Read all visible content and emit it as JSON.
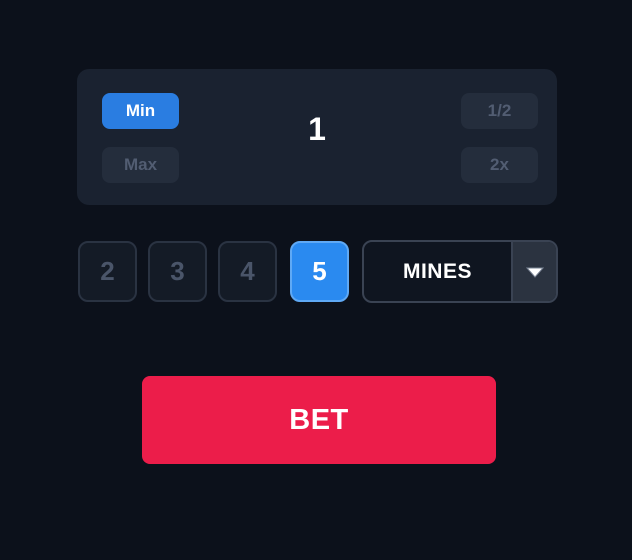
{
  "bet_amount": {
    "value": "1",
    "min_label": "Min",
    "max_label": "Max",
    "half_label": "1/2",
    "double_label": "2x"
  },
  "mines_count": {
    "options": [
      "2",
      "3",
      "4",
      "5"
    ],
    "selected": "5"
  },
  "mode_select": {
    "label": "MINES",
    "icon": "chevron-down-icon"
  },
  "bet_button": {
    "label": "BET"
  },
  "colors": {
    "background": "#0c111b",
    "panel": "#1a2230",
    "accent_blue": "#2a7de1",
    "bet_red": "#ec1d4a"
  }
}
